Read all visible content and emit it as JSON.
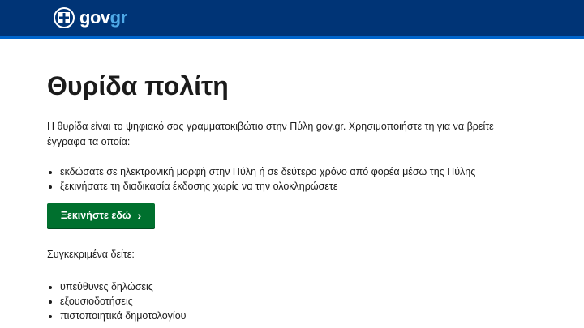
{
  "header": {
    "logo_gov": "gov",
    "logo_gr": "gr"
  },
  "main": {
    "title": "Θυρίδα πολίτη",
    "intro": "Η θυρίδα είναι το ψηφιακό σας γραμματοκιβώτιο στην Πύλη gov.gr. Χρησιμοποιήστε τη για να βρείτε έγγραφα τα οποία:",
    "bullets": [
      "εκδώσατε σε ηλεκτρονική μορφή στην Πύλη ή σε δεύτερο χρόνο από φορέα μέσω της Πύλης",
      "ξεκινήσατε τη διαδικασία έκδοσης χωρίς να την ολοκληρώσετε"
    ],
    "cta_label": "Ξεκινήστε εδώ",
    "cta_icon": "chevron-right-icon",
    "subheading": "Συγκεκριμένα δείτε:",
    "list2": [
      "υπεύθυνες δηλώσεις",
      "εξουσιοδοτήσεις",
      "πιστοποιητικά δημοτολογίου"
    ]
  },
  "colors": {
    "header_bg": "#003476",
    "header_accent": "#0065cc",
    "logo_gr": "#4faae8",
    "cta_bg": "#00702e"
  }
}
